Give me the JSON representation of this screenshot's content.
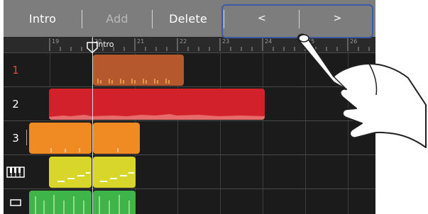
{
  "toolbar": {
    "intro_label": "Intro",
    "add_label": "Add",
    "delete_label": "Delete",
    "prev_label": "<",
    "next_label": ">"
  },
  "ruler": {
    "marker_label": "Intro",
    "bar_numbers": [
      "19",
      "20",
      "21",
      "22",
      "23",
      "24",
      "25",
      "26"
    ]
  },
  "tracks": [
    {
      "label": "1",
      "color": "#e14a3a"
    },
    {
      "label": "2",
      "color": "#ffffff"
    },
    {
      "label": "3",
      "color": "#ffffff"
    },
    {
      "label": "piano-icon",
      "color": "#ffffff"
    },
    {
      "label": "drum-icon",
      "color": "#ffffff"
    }
  ],
  "colors": {
    "track1_region": "#b5582e",
    "track2_region": "#d3212c",
    "track3_region": "#f08a22",
    "track4_region": "#d8d62a",
    "track5_region": "#3fb449",
    "nav_highlight": "#3d5aa6"
  }
}
